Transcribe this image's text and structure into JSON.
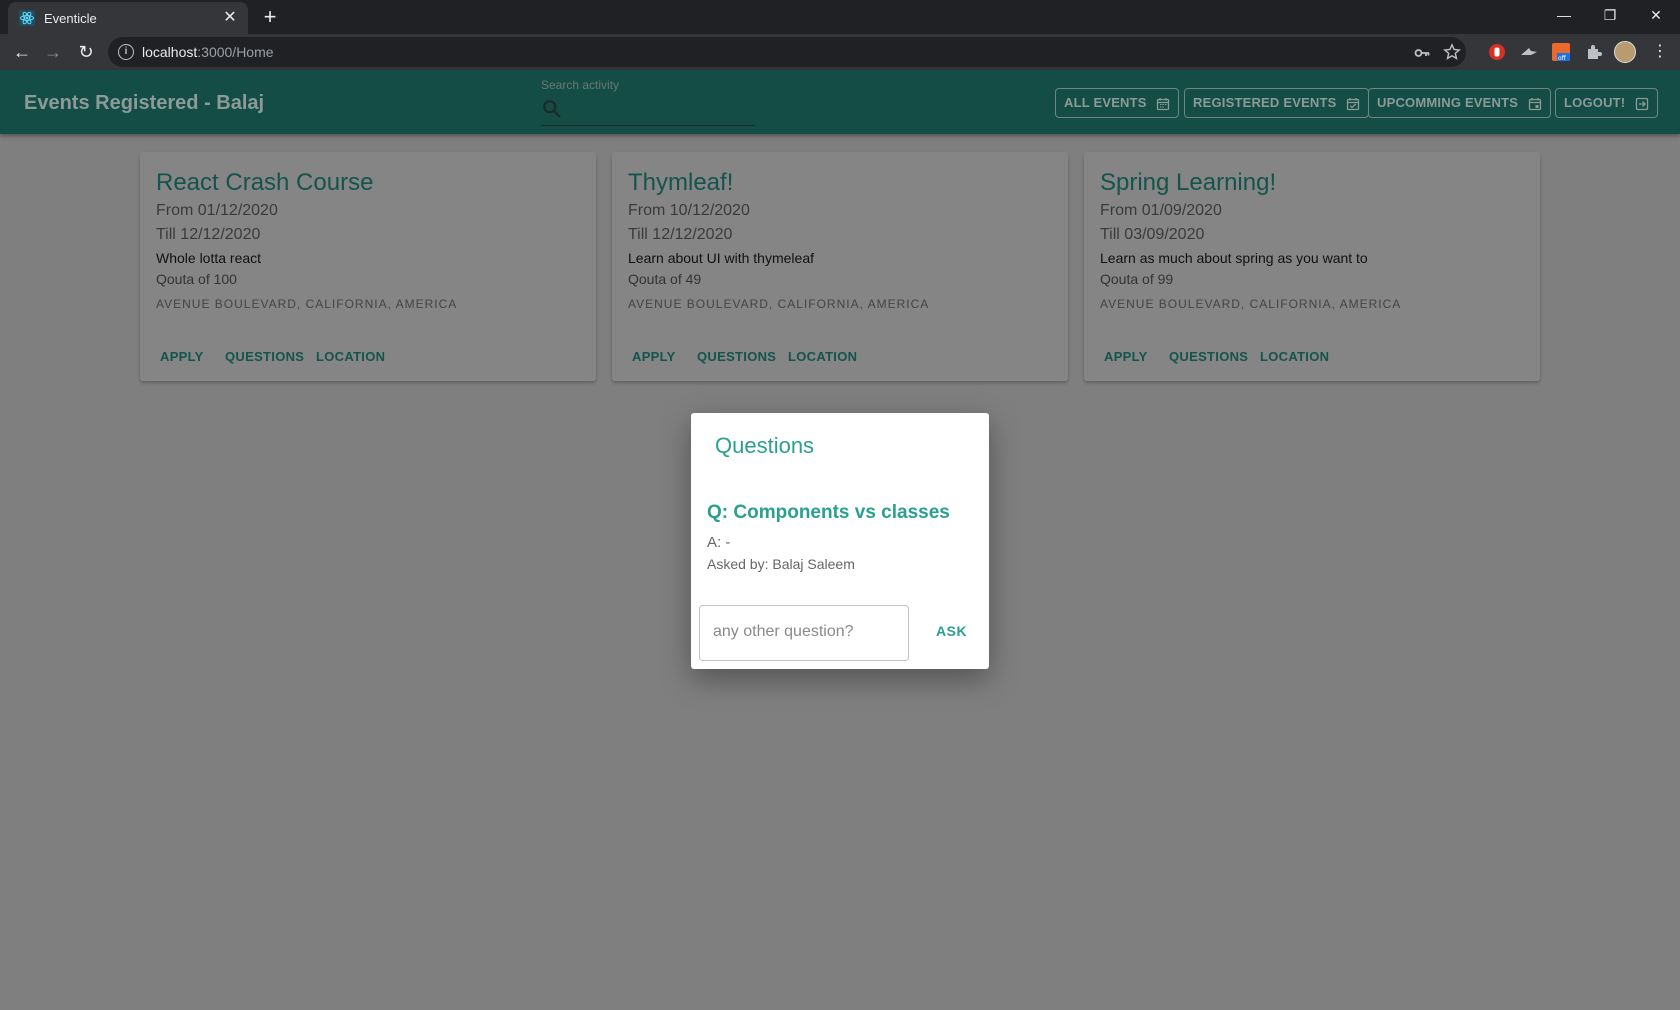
{
  "browser": {
    "tab_title": "Eventicle",
    "url_host": "localhost",
    "url_path": ":3000/Home"
  },
  "header": {
    "title": "Events Registered - Balaj",
    "search_label": "Search activity",
    "search_value": "",
    "nav": [
      "ALL EVENTS",
      "REGISTERED EVENTS",
      "UPCOMMING EVENTS",
      "LOGOUT!"
    ]
  },
  "events": [
    {
      "title": "React Crash Course",
      "from": "From 01/12/2020",
      "till": "Till 12/12/2020",
      "description": "Whole lotta react",
      "quota": "Qouta of 100",
      "address": "AVENUE BOULEVARD, CALIFORNIA, AMERICA",
      "buttons": [
        "APPLY",
        "QUESTIONS",
        "LOCATION"
      ]
    },
    {
      "title": "Thymleaf!",
      "from": "From 10/12/2020",
      "till": "Till 12/12/2020",
      "description": "Learn about UI with thymeleaf",
      "quota": "Qouta of 49",
      "address": "AVENUE BOULEVARD, CALIFORNIA, AMERICA",
      "buttons": [
        "APPLY",
        "QUESTIONS",
        "LOCATION"
      ]
    },
    {
      "title": "Spring Learning!",
      "from": "From 01/09/2020",
      "till": "Till 03/09/2020",
      "description": "Learn as much about spring as you want to",
      "quota": "Qouta of 99",
      "address": "AVENUE BOULEVARD, CALIFORNIA, AMERICA",
      "buttons": [
        "APPLY",
        "QUESTIONS",
        "LOCATION"
      ]
    }
  ],
  "dialog": {
    "title": "Questions",
    "question": "Q: Components vs classes",
    "answer": "A: -",
    "asked_by": "Asked by: Balaj Saleem",
    "input_value": "",
    "input_placeholder": "any other question?",
    "ask_label": "ASK"
  },
  "colors": {
    "accent": "#2aa090",
    "appbar_dimmed": "#134d45",
    "backdrop": "#7f7f7f"
  }
}
